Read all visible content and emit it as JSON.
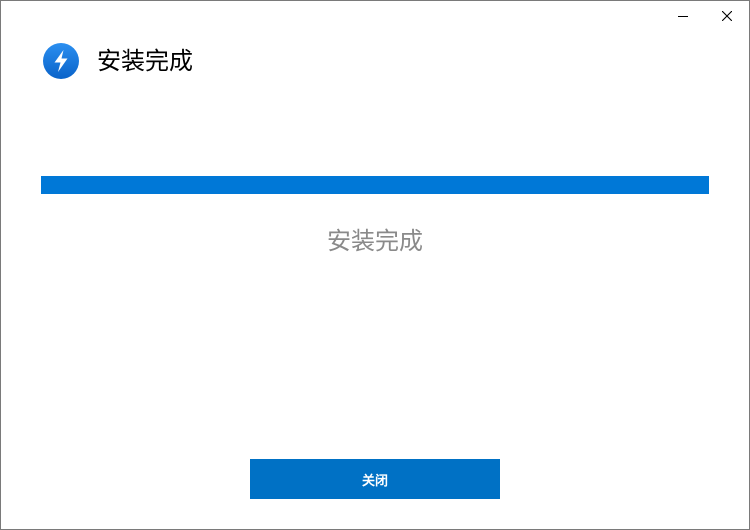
{
  "window": {
    "minimize_icon": "minimize-icon",
    "close_icon": "close-icon"
  },
  "header": {
    "logo_icon": "lightning-bolt-icon",
    "title": "安装完成"
  },
  "progress": {
    "value_percent": 100,
    "color": "#0078d7"
  },
  "status": {
    "text": "安装完成"
  },
  "footer": {
    "close_label": "关闭",
    "button_color": "#0071c5"
  }
}
